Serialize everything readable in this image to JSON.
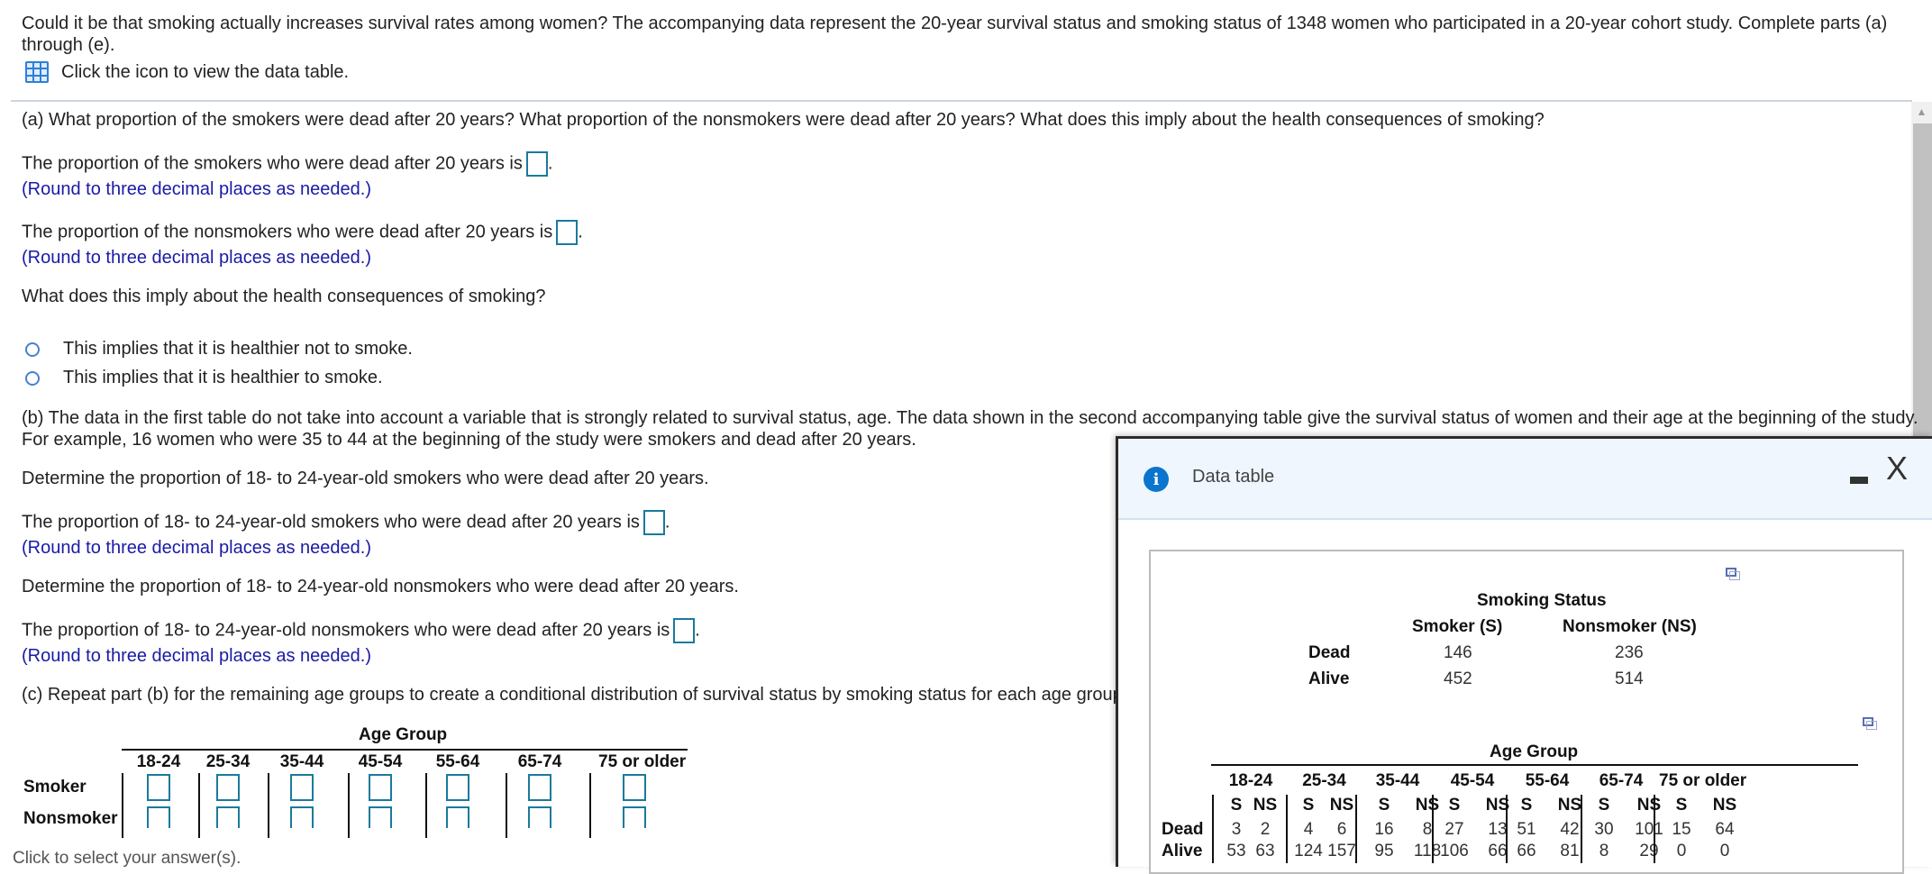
{
  "intro": {
    "text": "Could it be that smoking actually increases survival rates among women? The accompanying data represent the 20-year survival status and smoking status of 1348 women who participated in a 20-year cohort study. Complete parts (a) through (e).",
    "data_table_link": "Click the icon to view the data table.",
    "data_table_icon": "grid-table-icon"
  },
  "part_a": {
    "question": "(a) What proportion of the smokers were dead after 20 years? What proportion of the nonsmokers were dead after 20 years? What does this imply about the health consequences of smoking?",
    "smokers_prompt": "The proportion of the smokers who were dead after 20 years is",
    "smokers_value": "",
    "nonsmokers_prompt": "The proportion of the nonsmokers who were dead after 20 years is",
    "nonsmokers_value": "",
    "round_hint": "(Round to three decimal places as needed.)",
    "imply_question": "What does this imply about the health consequences of smoking?",
    "options": [
      "This implies that it is healthier not to smoke.",
      "This implies that it is healthier to smoke."
    ]
  },
  "part_b": {
    "intro_line1": "(b) The data in the first table do not take into account a variable that is strongly related to survival status, age. The data shown in the second accompanying table give the survival status of women and their age at the beginning of the study.",
    "intro_line2": "For example, 16 women who were 35 to 44 at the beginning of the study were smokers and dead after 20 years.",
    "determine_smokers": "Determine the proportion of 18- to 24-year-old smokers who were dead after 20 years.",
    "smokers_prompt": "The proportion of 18- to 24-year-old smokers who were dead after 20 years is",
    "determine_nonsmokers": "Determine the proportion of 18- to 24-year-old nonsmokers who were dead after 20 years.",
    "nonsmokers_prompt": "The proportion of 18- to 24-year-old nonsmokers who were dead after 20 years is",
    "round_hint": "(Round to three decimal places as needed.)"
  },
  "part_c": {
    "question": "(c) Repeat part (b) for the remaining age groups to create a conditional distribution of survival status by smoking status for each age group.",
    "table_title": "Age Group",
    "age_groups": [
      "18-24",
      "25-34",
      "35-44",
      "45-54",
      "55-64",
      "65-74",
      "75 or older"
    ],
    "row_labels": [
      "Smoker",
      "Nonsmoker"
    ]
  },
  "footer": {
    "click_to_select": "Click to select your answer(s)."
  },
  "dialog": {
    "title": "Data table",
    "minimize": "minimize",
    "close": "X",
    "table1": {
      "title": "Smoking Status",
      "columns": [
        "Smoker (S)",
        "Nonsmoker (NS)"
      ],
      "rows": [
        {
          "label": "Dead",
          "values": [
            "146",
            "236"
          ]
        },
        {
          "label": "Alive",
          "values": [
            "452",
            "514"
          ]
        }
      ]
    },
    "table2": {
      "title": "Age Group",
      "age_groups": [
        "18-24",
        "25-34",
        "35-44",
        "45-54",
        "55-64",
        "65-74",
        "75 or older"
      ],
      "sub_columns": [
        "S",
        "NS"
      ],
      "rows": [
        {
          "label": "Dead",
          "values": [
            "3",
            "2",
            "4",
            "6",
            "16",
            "8",
            "27",
            "13",
            "51",
            "42",
            "30",
            "101",
            "15",
            "64"
          ]
        },
        {
          "label": "Alive",
          "values": [
            "53",
            "63",
            "124",
            "157",
            "95",
            "118",
            "106",
            "66",
            "66",
            "81",
            "8",
            "29",
            "0",
            "0"
          ]
        }
      ]
    }
  },
  "colors": {
    "hint_blue": "#1a1aa6",
    "answer_box": "#1a7a9c",
    "info_blue": "#0b74cf",
    "dialog_header": "#f0f6fd"
  }
}
